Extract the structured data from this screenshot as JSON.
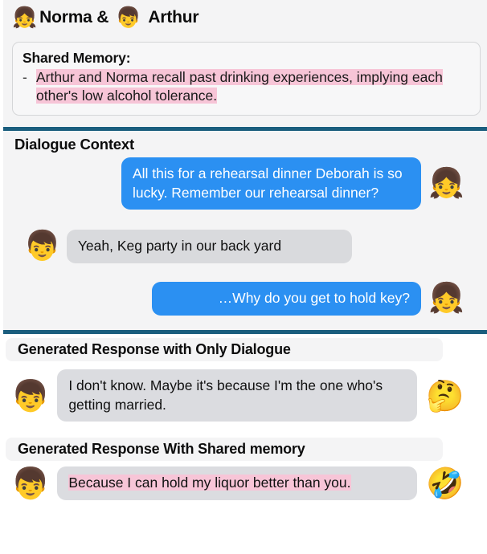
{
  "header": {
    "left_avatar_icon": "girl-emoji",
    "left_avatar_glyph": "👧",
    "left_name": "Norma &",
    "right_avatar_icon": "boy-emoji",
    "right_avatar_glyph": "👦",
    "right_name": "Arthur"
  },
  "shared_memory": {
    "label": "Shared Memory",
    "colon": ":",
    "bullet": "-",
    "highlighted_text": "Arthur and Norma recall past drinking experiences, implying each other's low alcohol tolerance.",
    "highlight_color": "#f7c5d7"
  },
  "dialogue": {
    "heading": "Dialogue Context",
    "messages": [
      {
        "speaker": "Norma",
        "side": "right",
        "avatar_glyph": "👧",
        "avatar_icon": "girl-emoji",
        "text": "All this for a rehearsal dinner Deborah is so lucky. Remember our rehearsal dinner?",
        "bubble_color": "#2b90f2"
      },
      {
        "speaker": "Arthur",
        "side": "left",
        "avatar_glyph": "👦",
        "avatar_icon": "boy-emoji",
        "text": "Yeah, Keg party in our back yard",
        "bubble_color": "#d9dadd"
      },
      {
        "speaker": "Norma",
        "side": "right",
        "avatar_glyph": "👧",
        "avatar_icon": "girl-emoji",
        "text": "…Why do you get to hold key?",
        "bubble_color": "#2b90f2"
      }
    ]
  },
  "responses": [
    {
      "section_label": "Generated Response with Only Dialogue",
      "avatar_glyph": "👦",
      "avatar_icon": "boy-emoji",
      "text": "I don't know. Maybe it's because I'm the one who's getting married.",
      "reaction_glyph": "🤔",
      "reaction_icon": "thinking-face-emoji",
      "highlighted": false
    },
    {
      "section_label": "Generated Response With Shared memory",
      "avatar_glyph": "👦",
      "avatar_icon": "boy-emoji",
      "text_highlighted": "Because I can hold my liquor better than you.",
      "reaction_glyph": "🤣",
      "reaction_icon": "rolling-on-floor-laughing-emoji",
      "highlighted": true
    }
  ],
  "colors": {
    "divider": "#1b5e7e",
    "panel_bg": "#f4f4f5",
    "page_bg": "#ffffff",
    "bubble_blue": "#2b90f2",
    "bubble_gray": "#d9dadd",
    "highlight_pink": "#f7c5d7"
  }
}
